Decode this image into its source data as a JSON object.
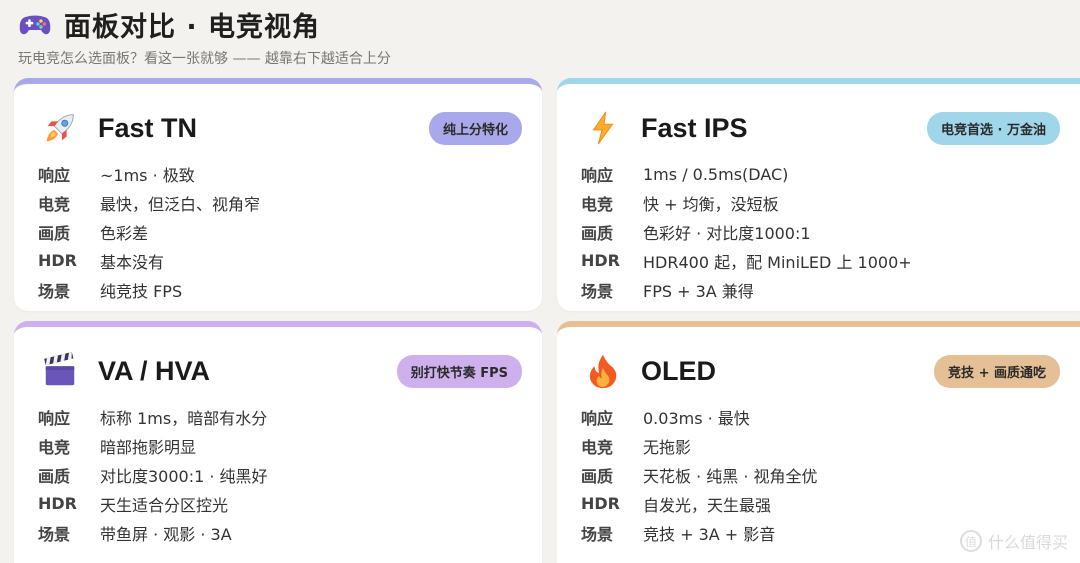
{
  "header": {
    "icon": "gamepad-icon",
    "title": "面板对比 · 电竞视角",
    "subtitle": "玩电竞怎么选面板？看这一张就够 —— 越靠右下越适合上分"
  },
  "colors": {
    "tn": "#a9a8ea",
    "ips": "#9fd6ea",
    "va": "#cdb0ec",
    "oled": "#e5bf95"
  },
  "cards": [
    {
      "name": "Fast TN",
      "icon": "rocket-icon",
      "badge": "纯上分特化",
      "rows": [
        {
          "label": "响应",
          "value": "~1ms · 极致"
        },
        {
          "label": "电竞",
          "value": "最快，但泛白、视角窄"
        },
        {
          "label": "画质",
          "value": "色彩差"
        },
        {
          "label": "HDR",
          "value": "基本没有"
        },
        {
          "label": "场景",
          "value": "纯竞技 FPS"
        }
      ]
    },
    {
      "name": "Fast IPS",
      "icon": "lightning-icon",
      "badge": "电竞首选 · 万金油",
      "rows": [
        {
          "label": "响应",
          "value": "1ms / 0.5ms(DAC)"
        },
        {
          "label": "电竞",
          "value": "快 + 均衡，没短板"
        },
        {
          "label": "画质",
          "value": "色彩好 · 对比度1000:1"
        },
        {
          "label": "HDR",
          "value": "HDR400 起，配 MiniLED 上 1000+"
        },
        {
          "label": "场景",
          "value": "FPS + 3A 兼得"
        }
      ]
    },
    {
      "name": "VA / HVA",
      "icon": "clapperboard-icon",
      "badge": "别打快节奏 FPS",
      "rows": [
        {
          "label": "响应",
          "value": "标称 1ms，暗部有水分"
        },
        {
          "label": "电竞",
          "value": "暗部拖影明显"
        },
        {
          "label": "画质",
          "value": "对比度3000:1 · 纯黑好"
        },
        {
          "label": "HDR",
          "value": "天生适合分区控光"
        },
        {
          "label": "场景",
          "value": "带鱼屏 · 观影 · 3A"
        }
      ]
    },
    {
      "name": "OLED",
      "icon": "fire-icon",
      "badge": "竞技 + 画质通吃",
      "rows": [
        {
          "label": "响应",
          "value": "0.03ms · 最快"
        },
        {
          "label": "电竞",
          "value": "无拖影"
        },
        {
          "label": "画质",
          "value": "天花板 · 纯黑 · 视角全优"
        },
        {
          "label": "HDR",
          "value": "自发光，天生最强"
        },
        {
          "label": "场景",
          "value": "竞技 + 3A + 影音"
        }
      ]
    }
  ],
  "watermark": {
    "mark": "值",
    "text": "什么值得买"
  }
}
